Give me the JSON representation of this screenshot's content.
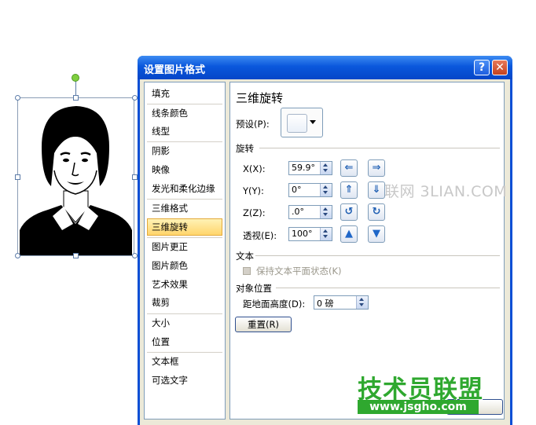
{
  "dialog": {
    "title": "设置图片格式",
    "help_label": "?",
    "close_label": "✕"
  },
  "nav": {
    "items": [
      "填充",
      "线条颜色",
      "线型",
      "阴影",
      "映像",
      "发光和柔化边缘",
      "三维格式",
      "三维旋转",
      "图片更正",
      "图片颜色",
      "艺术效果",
      "裁剪",
      "大小",
      "位置",
      "文本框",
      "可选文字"
    ],
    "selected": "三维旋转"
  },
  "panel": {
    "heading": "三维旋转",
    "preset_label": "预设(P):",
    "rotation_section": "旋转",
    "x_label": "X(X):",
    "x_value": "59.9°",
    "y_label": "Y(Y):",
    "y_value": "0°",
    "z_label": "Z(Z):",
    "z_value": ".0°",
    "perspective_label": "透视(E):",
    "perspective_value": "100°",
    "text_section": "文本",
    "keep_flat_label": "保持文本平面状态(K)",
    "object_position_section": "对象位置",
    "distance_label": "距地面高度(D):",
    "distance_value": "0 磅",
    "reset_label": "重置(R)"
  },
  "watermarks": {
    "top": "联网 3LIAN.COM",
    "brand": "技术员联盟",
    "url": "www.jsgho.com"
  }
}
